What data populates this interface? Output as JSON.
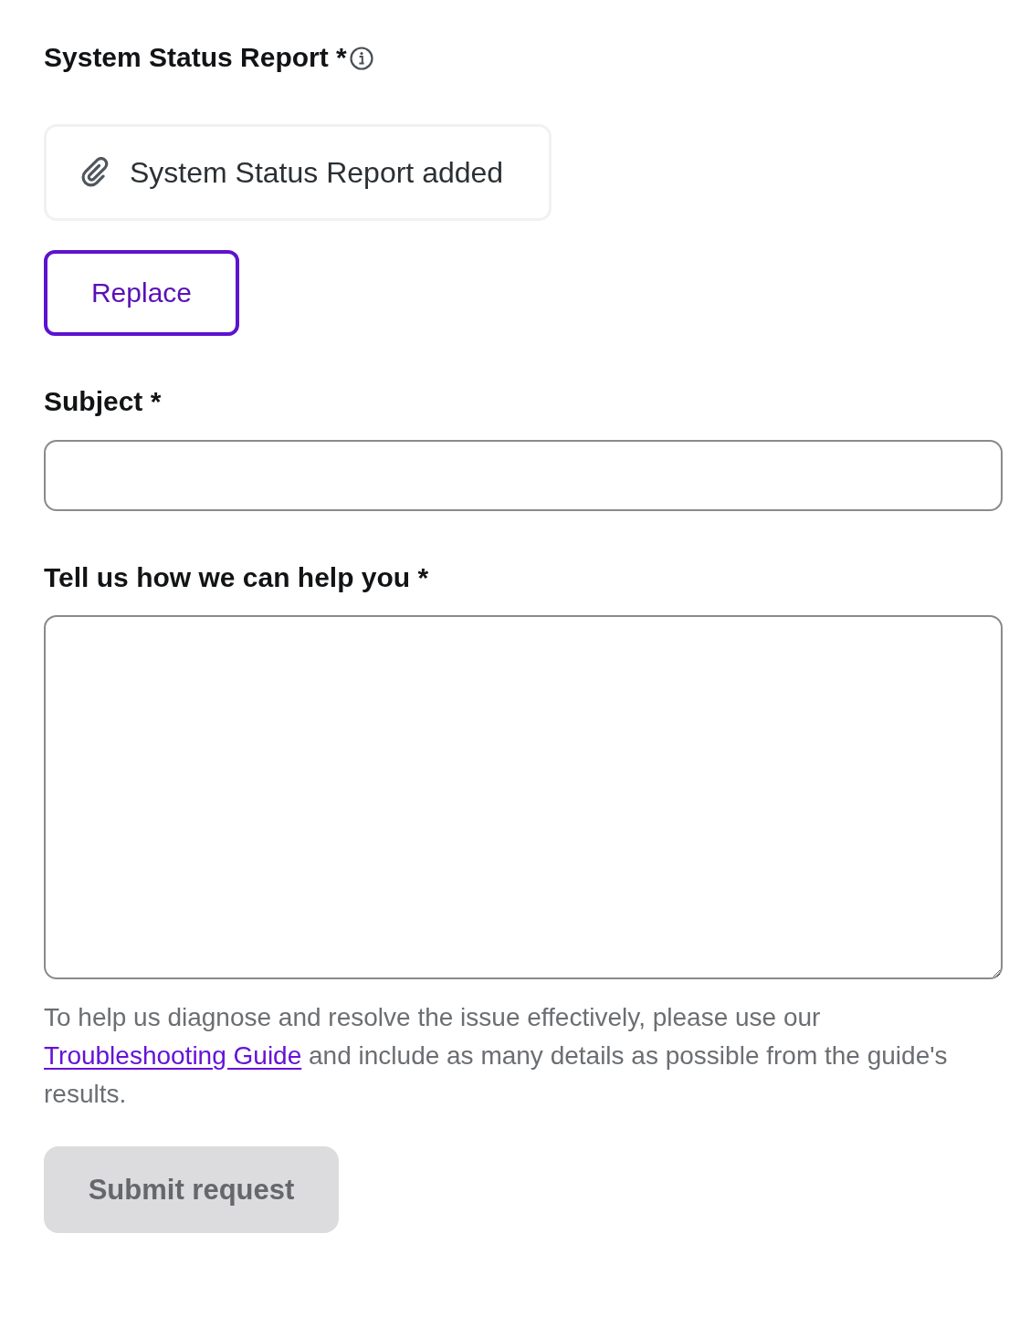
{
  "report_field": {
    "label": "System Status Report",
    "required_mark": "*",
    "attachment": {
      "text": "System Status Report added"
    },
    "replace_button": {
      "label": "Replace"
    }
  },
  "subject_field": {
    "label": "Subject",
    "required_mark": "*"
  },
  "description_field": {
    "label": "Tell us how we can help you",
    "required_mark": "*"
  },
  "help_text": {
    "before": "To help us diagnose and resolve the issue effectively, please use our",
    "link": "Troubleshooting Guide",
    "after": "and include as many details as possible from the guide's results."
  },
  "submit_button": {
    "label": "Submit request",
    "disabled": true
  }
}
